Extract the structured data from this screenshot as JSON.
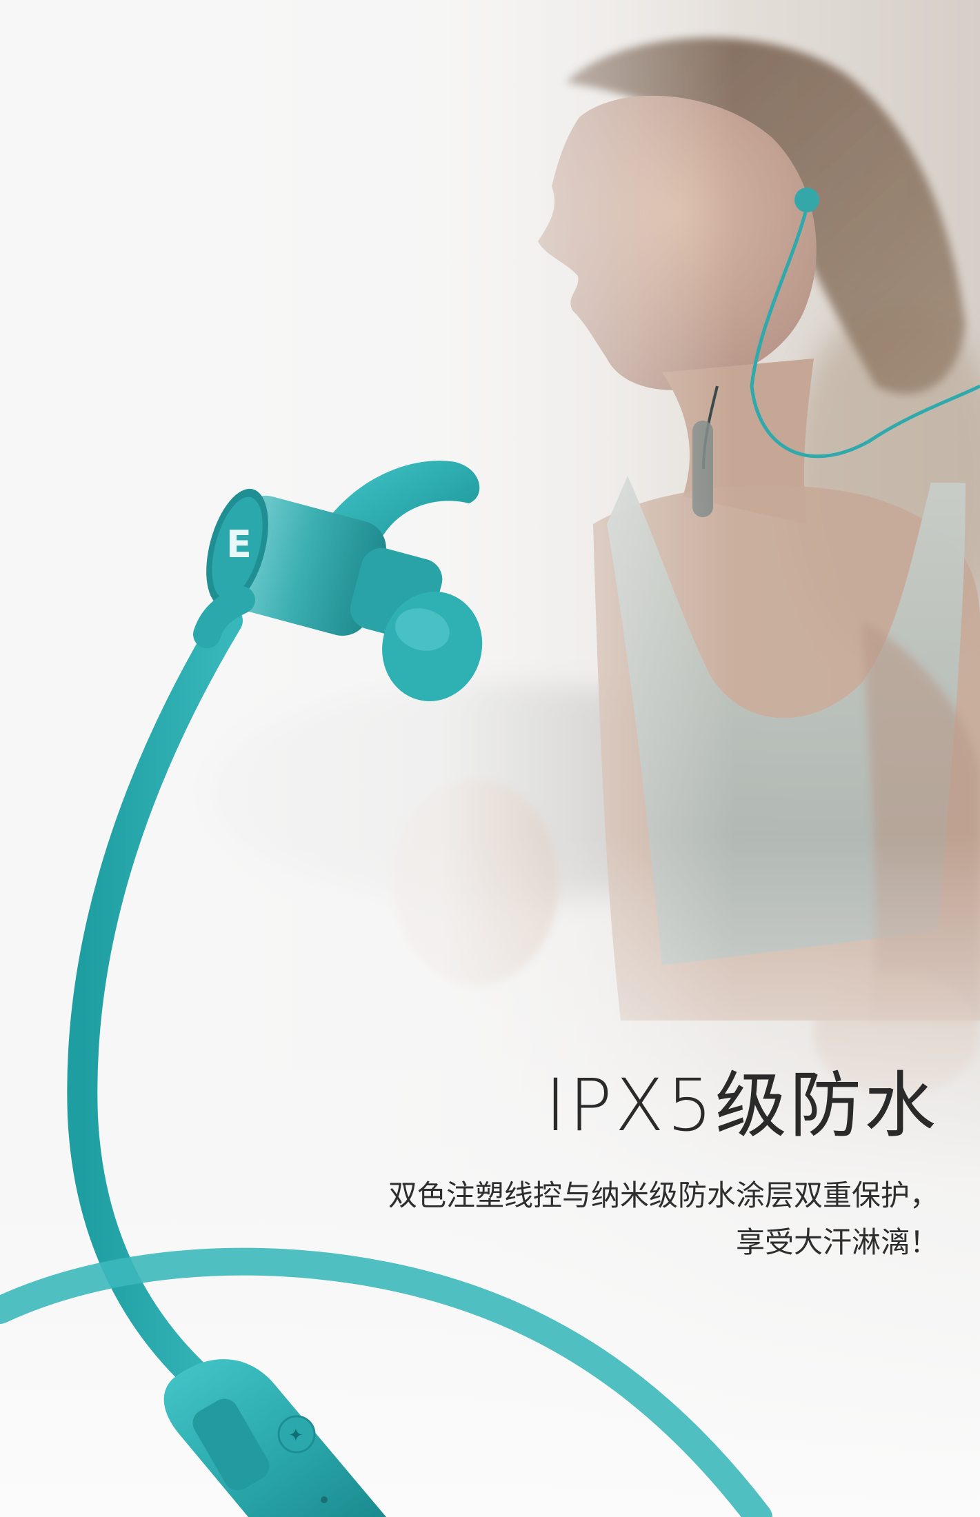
{
  "headline": "IPX5级防水",
  "description": {
    "line1": "双色注塑线控与纳米级防水涂层双重保护，",
    "line2": "享受大汗淋漓！"
  },
  "brand_mark": "E",
  "colors": {
    "product_teal": "#2fb3b6",
    "product_teal_dark": "#1d8f93",
    "text": "#2a2a2a",
    "background": "#f6f6f6"
  },
  "images": {
    "runner": "woman-running-wearing-earphones-photo",
    "product": "teal-sport-earphone-closeup"
  }
}
